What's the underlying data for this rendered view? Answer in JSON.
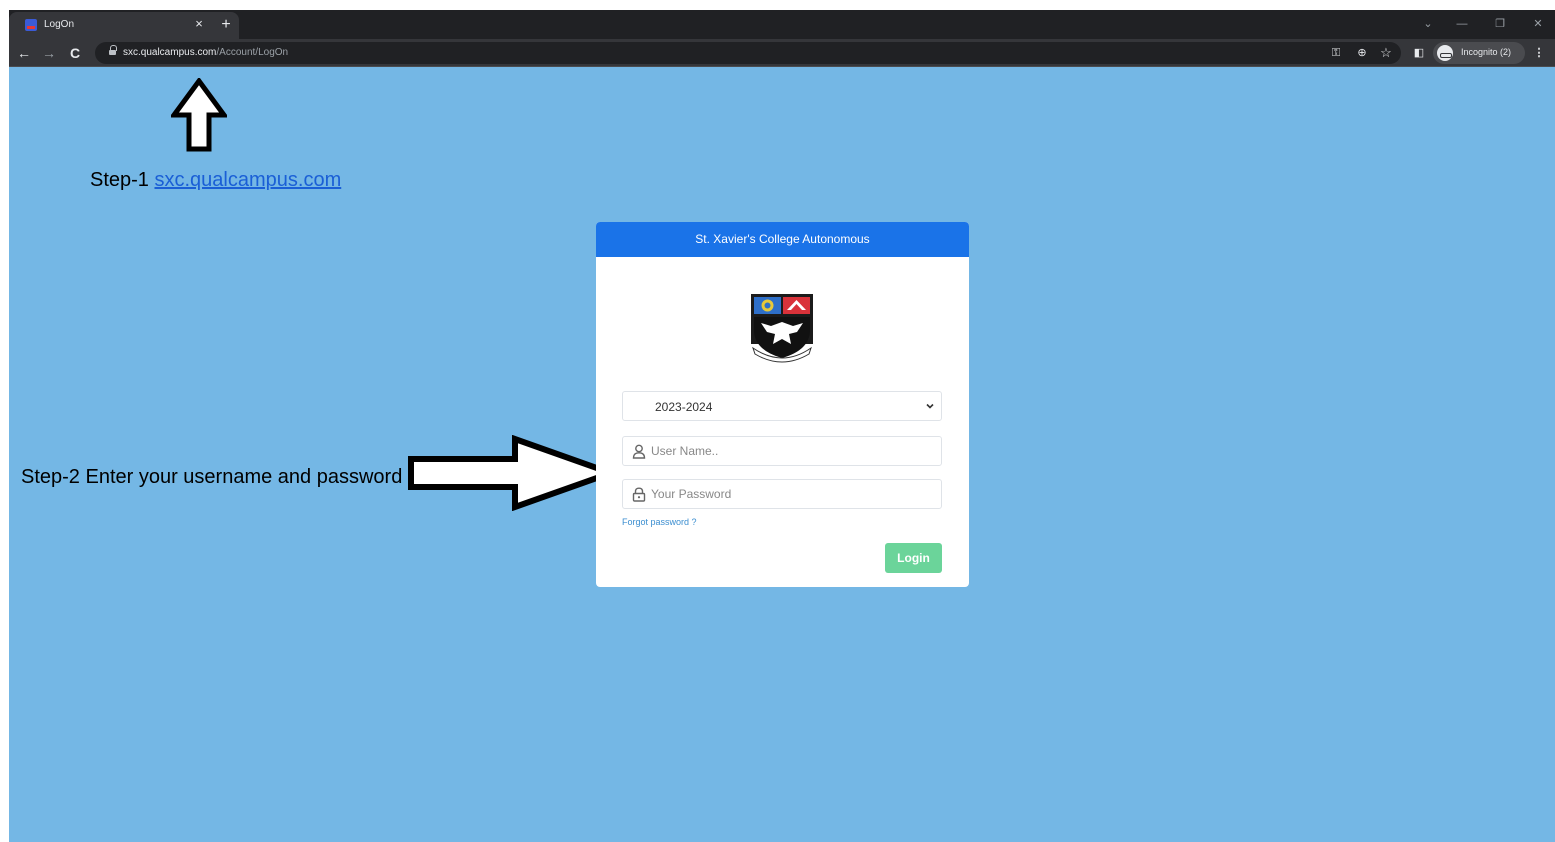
{
  "browser": {
    "tab_title": "LogOn",
    "tab_close": "×",
    "new_tab": "+",
    "url_host": "sxc.qualcampus.com",
    "url_path": "/Account/LogOn",
    "profile_label": "Incognito (2)",
    "window_controls": [
      "⌄",
      "—",
      "❐",
      "✕"
    ]
  },
  "annotations": {
    "step1_prefix": "Step-1 ",
    "step1_link": "sxc.qualcampus.com",
    "step2_text": "Step-2 Enter your username and password"
  },
  "login": {
    "header": "St. Xavier's College Autonomous",
    "year_selected": "2023-2024",
    "username_placeholder": "User Name..",
    "password_placeholder": "Your Password",
    "forgot_password": "Forgot password ?",
    "login_label": "Login"
  },
  "colors": {
    "page_background": "#74b7e5",
    "card_header": "#1a73e8",
    "login_button": "#6bd49a",
    "link": "#1a5fd6"
  }
}
